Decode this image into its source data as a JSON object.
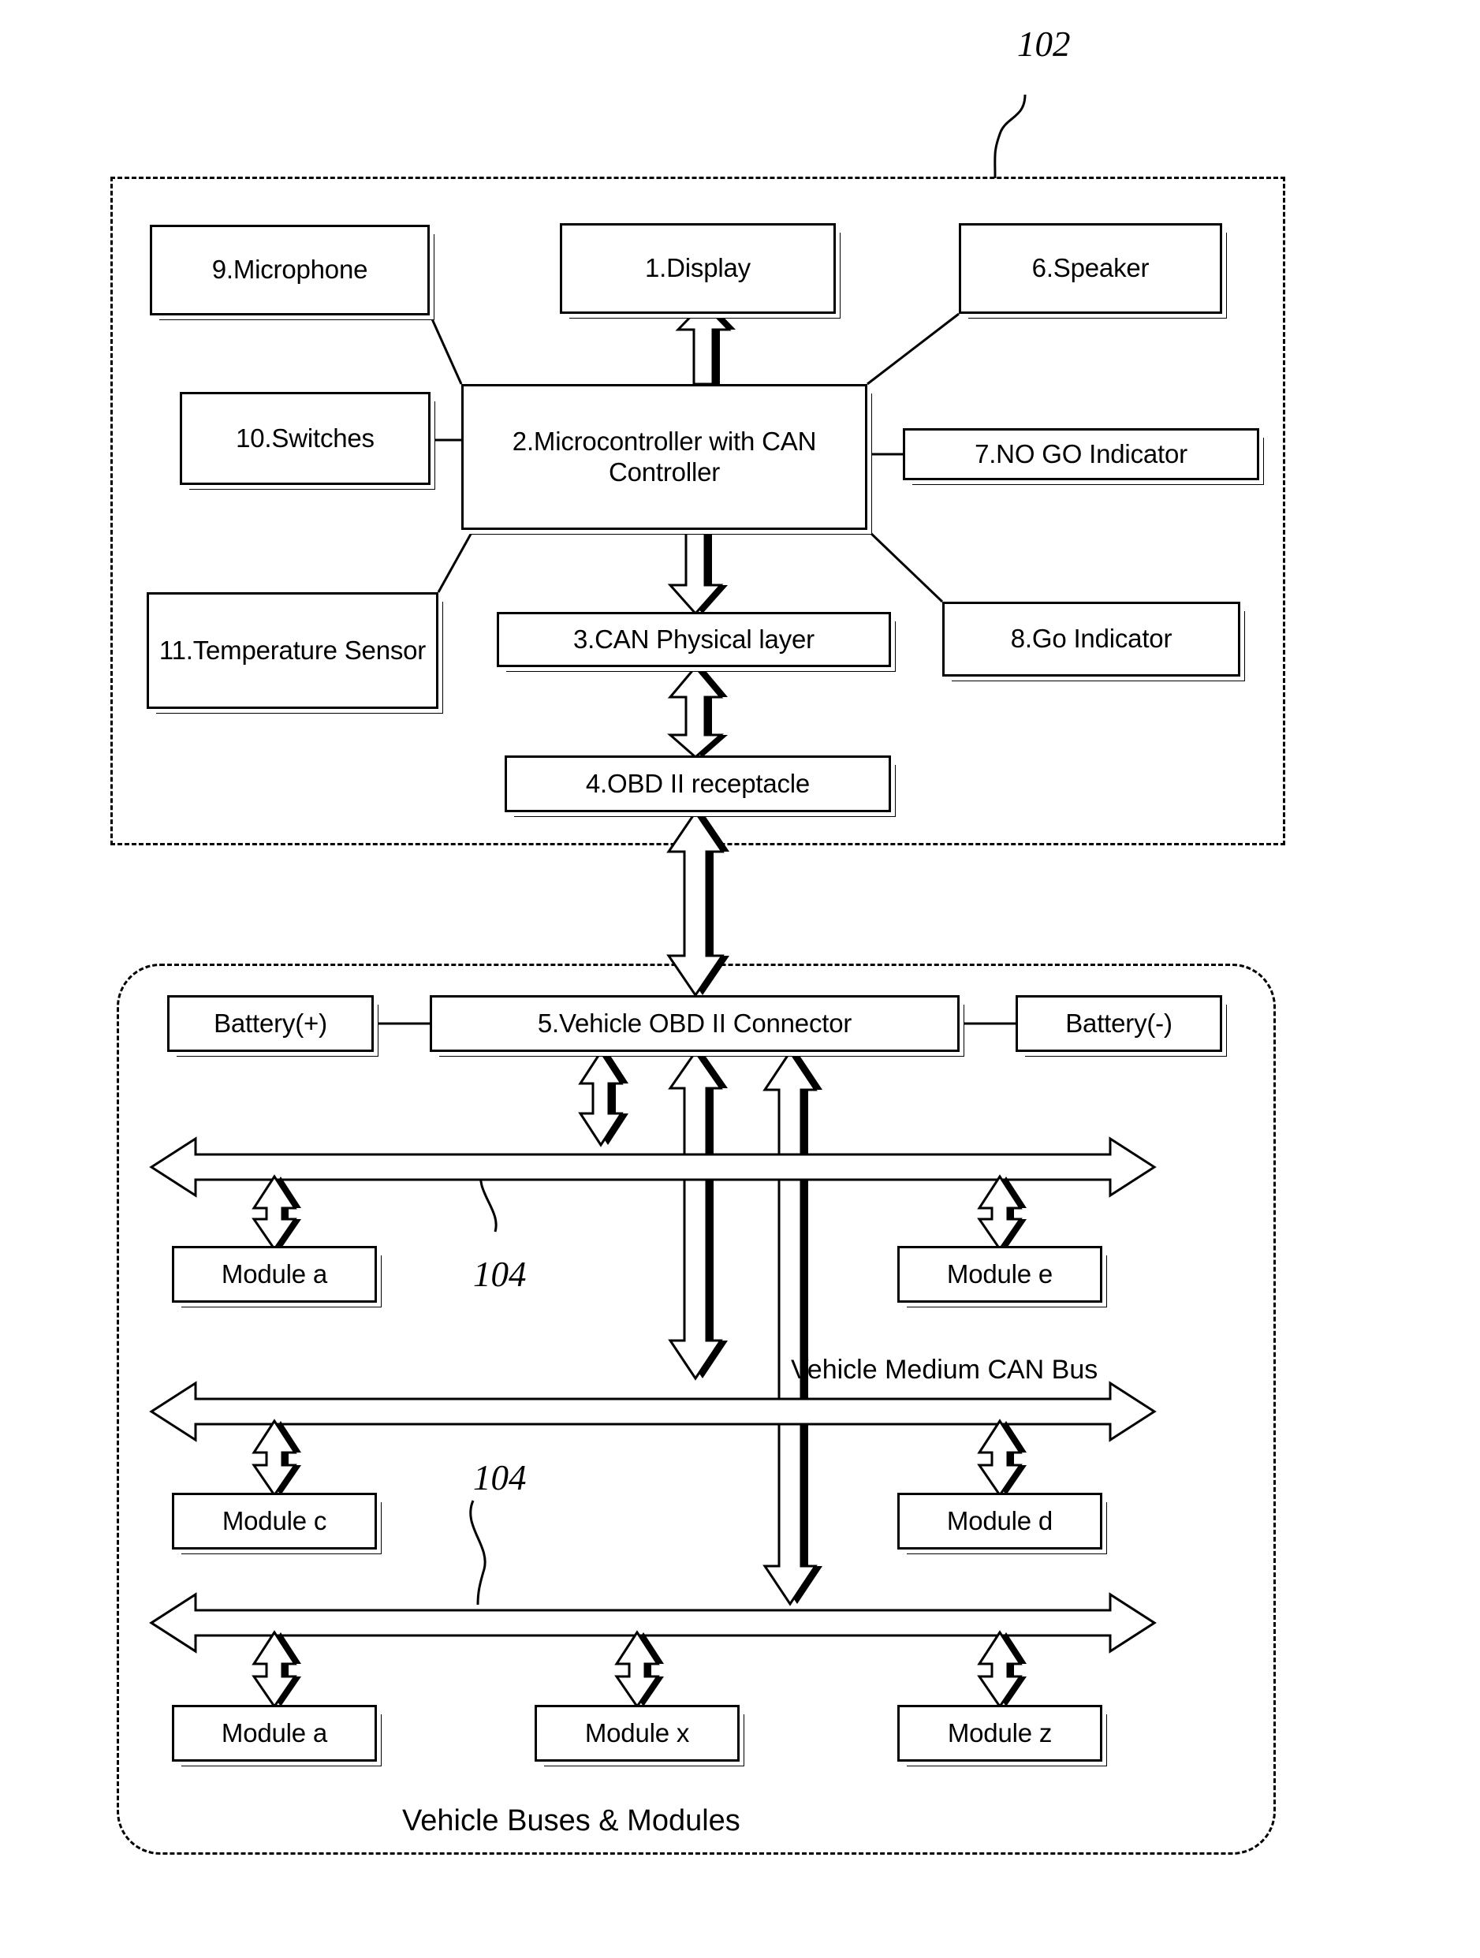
{
  "figure": {
    "type": "block-diagram",
    "reference_numerals": [
      {
        "id": "ref-102",
        "label": "102",
        "points_to": "diagnostic-tool-enclosure"
      },
      {
        "id": "ref-104-upper",
        "label": "104",
        "points_to": "vehicle-can-bus-upper"
      },
      {
        "id": "ref-104-lower",
        "label": "104",
        "points_to": "vehicle-can-bus-lower"
      }
    ]
  },
  "tool": {
    "enclosure_ref": "102",
    "blocks": {
      "display": "1.Display",
      "microcontroller": "2.Microcontroller with CAN Controller",
      "can_physical_layer": "3.CAN Physical layer",
      "obd_receptacle": "4.OBD II receptacle",
      "speaker": "6.Speaker",
      "no_go_indicator": "7.NO GO Indicator",
      "go_indicator": "8.Go Indicator",
      "microphone": "9.Microphone",
      "switches": "10.Switches",
      "temperature_sensor": "11.Temperature Sensor"
    }
  },
  "vehicle": {
    "caption": "Vehicle Buses & Modules",
    "connector": "5.Vehicle OBD II Connector",
    "battery_positive": "Battery(+)",
    "battery_negative": "Battery(-)",
    "buses": [
      {
        "name": "bus-upper",
        "label": "",
        "ref": "104",
        "modules": [
          "Module a",
          "Module e"
        ]
      },
      {
        "name": "bus-middle",
        "label": "Vehicle Medium CAN Bus",
        "ref": "104",
        "modules": [
          "Module c",
          "Module d"
        ]
      },
      {
        "name": "bus-lower",
        "label": "",
        "modules": [
          "Module a",
          "Module x",
          "Module z"
        ]
      }
    ],
    "modules": {
      "a1": "Module a",
      "e": "Module e",
      "c": "Module c",
      "d": "Module d",
      "a2": "Module a",
      "x": "Module x",
      "z": "Module z"
    },
    "bus_label_middle": "Vehicle Medium CAN Bus"
  },
  "colors": {
    "stroke": "#000000",
    "fill": "#ffffff"
  }
}
